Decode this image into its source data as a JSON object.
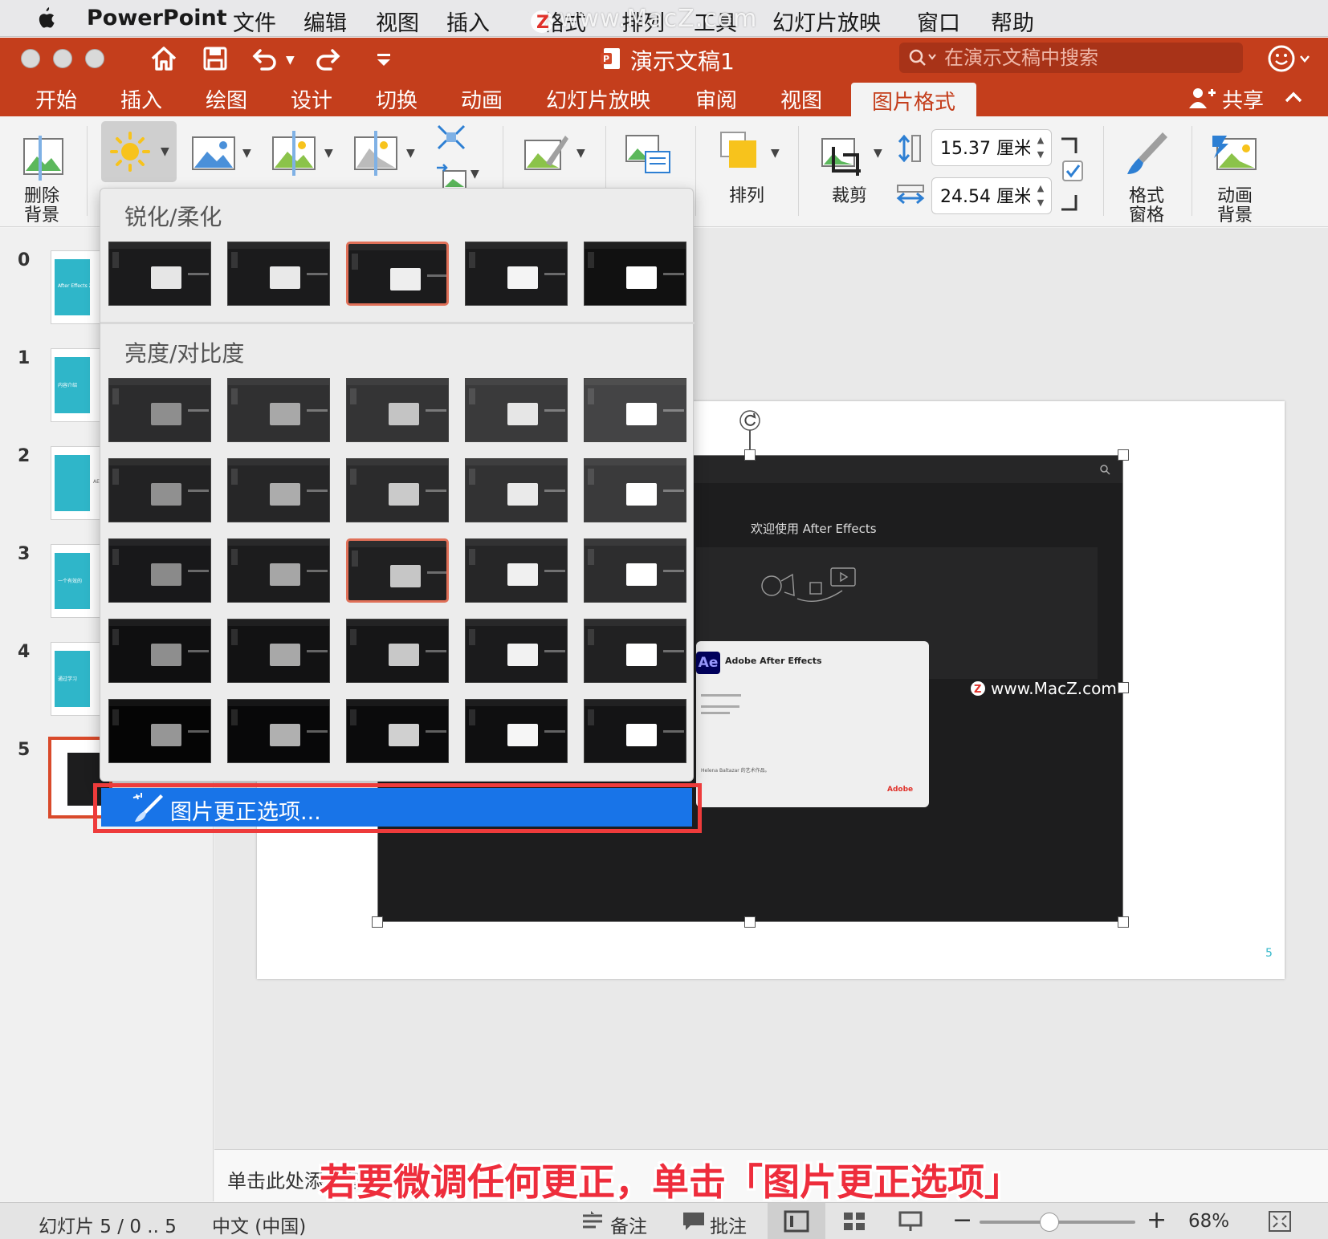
{
  "menubar": {
    "app_name": "PowerPoint",
    "items": [
      "文件",
      "编辑",
      "视图",
      "插入",
      "格式",
      "排列",
      "工具",
      "幻灯片放映",
      "窗口",
      "帮助"
    ],
    "watermark": "www.MacZ.com"
  },
  "titlebar": {
    "doc_title": "演示文稿1",
    "search_placeholder": "在演示文稿中搜索"
  },
  "tabs": [
    {
      "label": "开始"
    },
    {
      "label": "插入"
    },
    {
      "label": "绘图"
    },
    {
      "label": "设计"
    },
    {
      "label": "切换"
    },
    {
      "label": "动画"
    },
    {
      "label": "幻灯片放映"
    },
    {
      "label": "审阅"
    },
    {
      "label": "视图"
    },
    {
      "label": "图片格式",
      "active": true
    }
  ],
  "share_label": "共享",
  "ribbon": {
    "remove_bg_l1": "删除",
    "remove_bg_l2": "背景",
    "arrange": "排列",
    "crop": "裁剪",
    "height_value": "15.37 厘米",
    "width_value": "24.54 厘米",
    "format_pane_l1": "格式",
    "format_pane_l2": "窗格",
    "anim_bg_l1": "动画",
    "anim_bg_l2": "背景"
  },
  "gallery": {
    "section_sharpen": "锐化/柔化",
    "section_brightness": "亮度/对比度",
    "options_label": "图片更正选项..."
  },
  "thumbs": [
    {
      "num": "0",
      "text": "After Effects 202"
    },
    {
      "num": "1",
      "text": "内容介绍"
    },
    {
      "num": "2",
      "text": "AE"
    },
    {
      "num": "3",
      "text": "一个有效的"
    },
    {
      "num": "4",
      "text": "通过学习"
    },
    {
      "num": "5",
      "text": ""
    }
  ],
  "slide": {
    "welcome": "欢迎使用 After Effects",
    "ae_badge": "Ae",
    "splash_title": "Adobe After Effects",
    "splash_credit": "Helena Baltazar 的艺术作品。",
    "adobe_brand": "Adobe",
    "watermark": "www.MacZ.com",
    "page_number": "5"
  },
  "notes_placeholder": "单击此处添加备注",
  "caption": "若要微调任何更正，单击「图片更正选项」",
  "statusbar": {
    "slide_info": "幻灯片 5 / 0 .. 5",
    "language": "中文 (中国)",
    "notes": "备注",
    "comments": "批注",
    "zoom": "68%",
    "zoom_fraction": 0.45
  },
  "colors": {
    "accent": "#c43e1c",
    "menu_highlight": "#1874e8",
    "callout_red": "#ee3b3b",
    "selection": "#e07058",
    "teal": "#2fb6c9"
  }
}
